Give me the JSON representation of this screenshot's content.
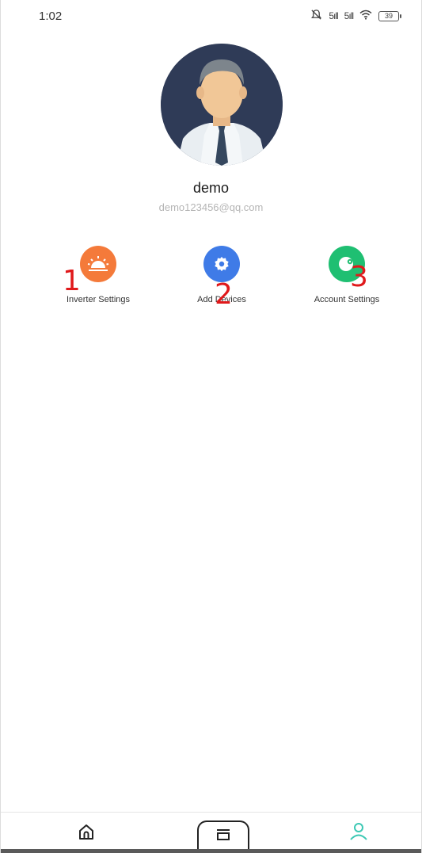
{
  "status_bar": {
    "time": "1:02",
    "signal_1": "5ıll",
    "signal_2": "5ıll",
    "battery": "39"
  },
  "profile": {
    "username": "demo",
    "email": "demo123456@qq.com"
  },
  "shortcuts": [
    {
      "label": "Inverter Settings",
      "icon": "sunrise-icon",
      "color": "#f47a3a",
      "annotation": "1"
    },
    {
      "label": "Add Devices",
      "icon": "gear-icon",
      "color": "#3f7be7",
      "annotation": "2"
    },
    {
      "label": "Account Settings",
      "icon": "account-settings-icon",
      "color": "#1fbf72",
      "annotation": "3"
    }
  ],
  "bottom_nav": {
    "items": [
      {
        "icon": "home-icon"
      },
      {
        "icon": "device-icon"
      },
      {
        "icon": "user-icon",
        "active_color": "#3cc8b4"
      }
    ]
  }
}
